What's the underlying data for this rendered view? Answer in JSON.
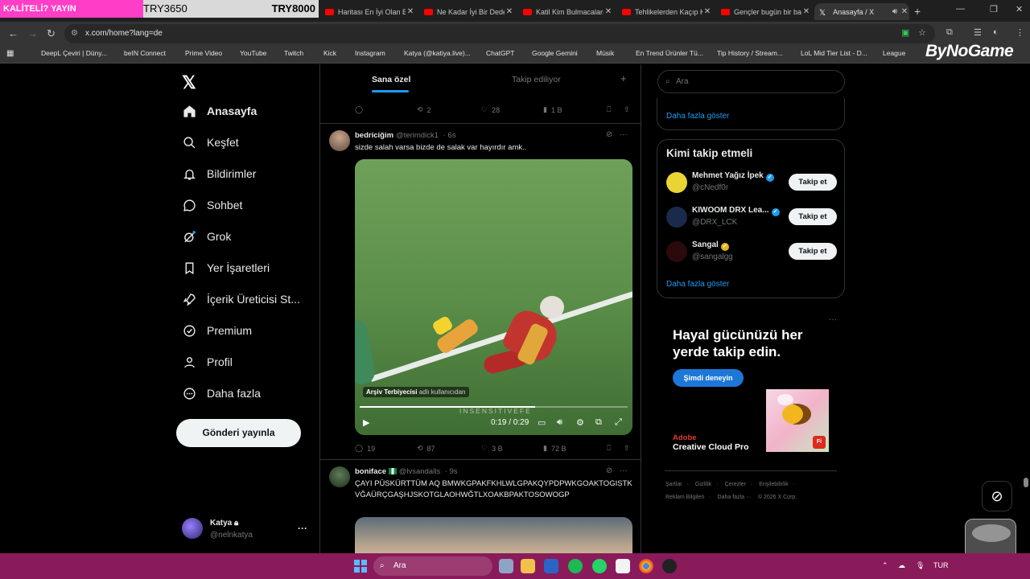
{
  "stream_banner": {
    "left_text": "KALİTELİ? YAYIN",
    "mid_text": "TRY3650",
    "right_text": "TRY8000"
  },
  "tabs": [
    {
      "title": "Haritası En İyi Olan B",
      "active": false
    },
    {
      "title": "Ne Kadar İyi Bir Dede",
      "active": false
    },
    {
      "title": "Katil Kim Bulmacaları",
      "active": false
    },
    {
      "title": "Tehlikelerden Kaçıp K",
      "active": false
    },
    {
      "title": "Gençler bugün bir ba",
      "active": false
    },
    {
      "title": "Anasayfa / X",
      "active": true
    }
  ],
  "address_bar": {
    "url": "x.com/home?lang=de"
  },
  "bookmarks": [
    {
      "label": "DeepL Çeviri | Düny...",
      "color": "#0f2b46"
    },
    {
      "label": "beIN Connect",
      "color": "#5a2ca0"
    },
    {
      "label": "Prime Video",
      "color": "#1a98ff"
    },
    {
      "label": "YouTube",
      "color": "#ff0000"
    },
    {
      "label": "Twitch",
      "color": "#9146ff"
    },
    {
      "label": "Kick",
      "color": "#53fc18"
    },
    {
      "label": "Instagram",
      "color": "#d6249f"
    },
    {
      "label": "Katya (@katiya.live)...",
      "color": "#000000"
    },
    {
      "label": "ChatGPT",
      "color": "#ffffff"
    },
    {
      "label": "Google Gemini",
      "color": "#4a8af4"
    },
    {
      "label": "Müsik",
      "color": "#888888"
    },
    {
      "label": "En Trend Ürünler Tü...",
      "color": "#f27a1a"
    },
    {
      "label": "Tip History / Stream...",
      "color": "#2ecc71"
    },
    {
      "label": "LoL Mid Tier List - D...",
      "color": "#3b5998"
    },
    {
      "label": "League",
      "color": "#c89b3c"
    }
  ],
  "overlay_logo": "ByNoGame",
  "nav": {
    "items": [
      {
        "label": "Anasayfa",
        "icon": "home-icon"
      },
      {
        "label": "Keşfet",
        "icon": "search-icon"
      },
      {
        "label": "Bildirimler",
        "icon": "bell-icon"
      },
      {
        "label": "Sohbet",
        "icon": "chat-icon"
      },
      {
        "label": "Grok",
        "icon": "grok-icon"
      },
      {
        "label": "Yer İşaretleri",
        "icon": "bookmark-icon"
      },
      {
        "label": "İçerik Üreticisi St...",
        "icon": "rocket-icon"
      },
      {
        "label": "Premium",
        "icon": "premium-icon"
      },
      {
        "label": "Profil",
        "icon": "person-icon"
      },
      {
        "label": "Daha fazla",
        "icon": "more-circle-icon"
      }
    ],
    "post_button": "Gönderi yayınla",
    "account": {
      "name": "Katya",
      "handle": "@nelnkatya"
    }
  },
  "feed": {
    "tabs": {
      "active": "Sana özel",
      "inactive": "Takip ediliyor"
    },
    "top_actions": {
      "replies": "",
      "reposts": "2",
      "likes": "28",
      "views": "1 B"
    },
    "tweet1": {
      "name": "bedriciğim",
      "handle": "@terimdick1",
      "time": "· 6s",
      "text": "sizde salah varsa bizde de salak var hayırdır amk..",
      "video": {
        "attribution_name": "Arşiv Terbiyecisi",
        "attribution_suffix": "adlı kullanıcıdan",
        "watermark": "INSENSITIVEFE",
        "time": "0:19 / 0:29",
        "progress": 0.655
      },
      "actions": {
        "replies": "19",
        "reposts": "87",
        "likes": "3 B",
        "views": "72 B"
      }
    },
    "tweet2": {
      "name": "boniface",
      "handle": "@lvsandalls",
      "time": "· 9s",
      "text": "ÇAYI PÜSKÜRTTÜM AQ BMWKGPAKFKHLWLGPAKQYPDPWKGOAKTOGISTKVĞAÜRÇGAŞHJSKOTGLAOHWĞTLXOAKBPAKTOSOWOGP"
    }
  },
  "right": {
    "search_placeholder": "Ara",
    "show_more": "Daha fazla göster",
    "who_to_follow_title": "Kimi takip etmeli",
    "suggestions": [
      {
        "name": "Mehmet Yağız İpek",
        "handle": "@cNedf0r",
        "badge": "blue",
        "avatar_color": "#e8d435"
      },
      {
        "name": "KIWOOM DRX Lea...",
        "handle": "@DRX_LCK",
        "badge": "blue",
        "avatar_color": "#1a2a4a"
      },
      {
        "name": "Sangal",
        "handle": "@sangalgg",
        "badge": "gold",
        "avatar_color": "#2a0a0a"
      }
    ],
    "follow_label": "Takip et",
    "show_more2": "Daha fazla göster",
    "ad": {
      "title": "Hayal gücünüzü her yerde takip edin.",
      "cta": "Şimdi deneyin",
      "brand_line1": "Adobe",
      "brand_line2": "Creative Cloud Pro",
      "badge": "Fi"
    },
    "footer_line1": [
      "Şartlar",
      "Gizlilik",
      "Çerezler",
      "Erişilebilirlik"
    ],
    "footer_line2": [
      "Reklam Bilgileri",
      "Daha fazla ···",
      "© 2026 X Corp."
    ]
  },
  "taskbar": {
    "search_placeholder": "Ara",
    "lang": "TUR"
  }
}
